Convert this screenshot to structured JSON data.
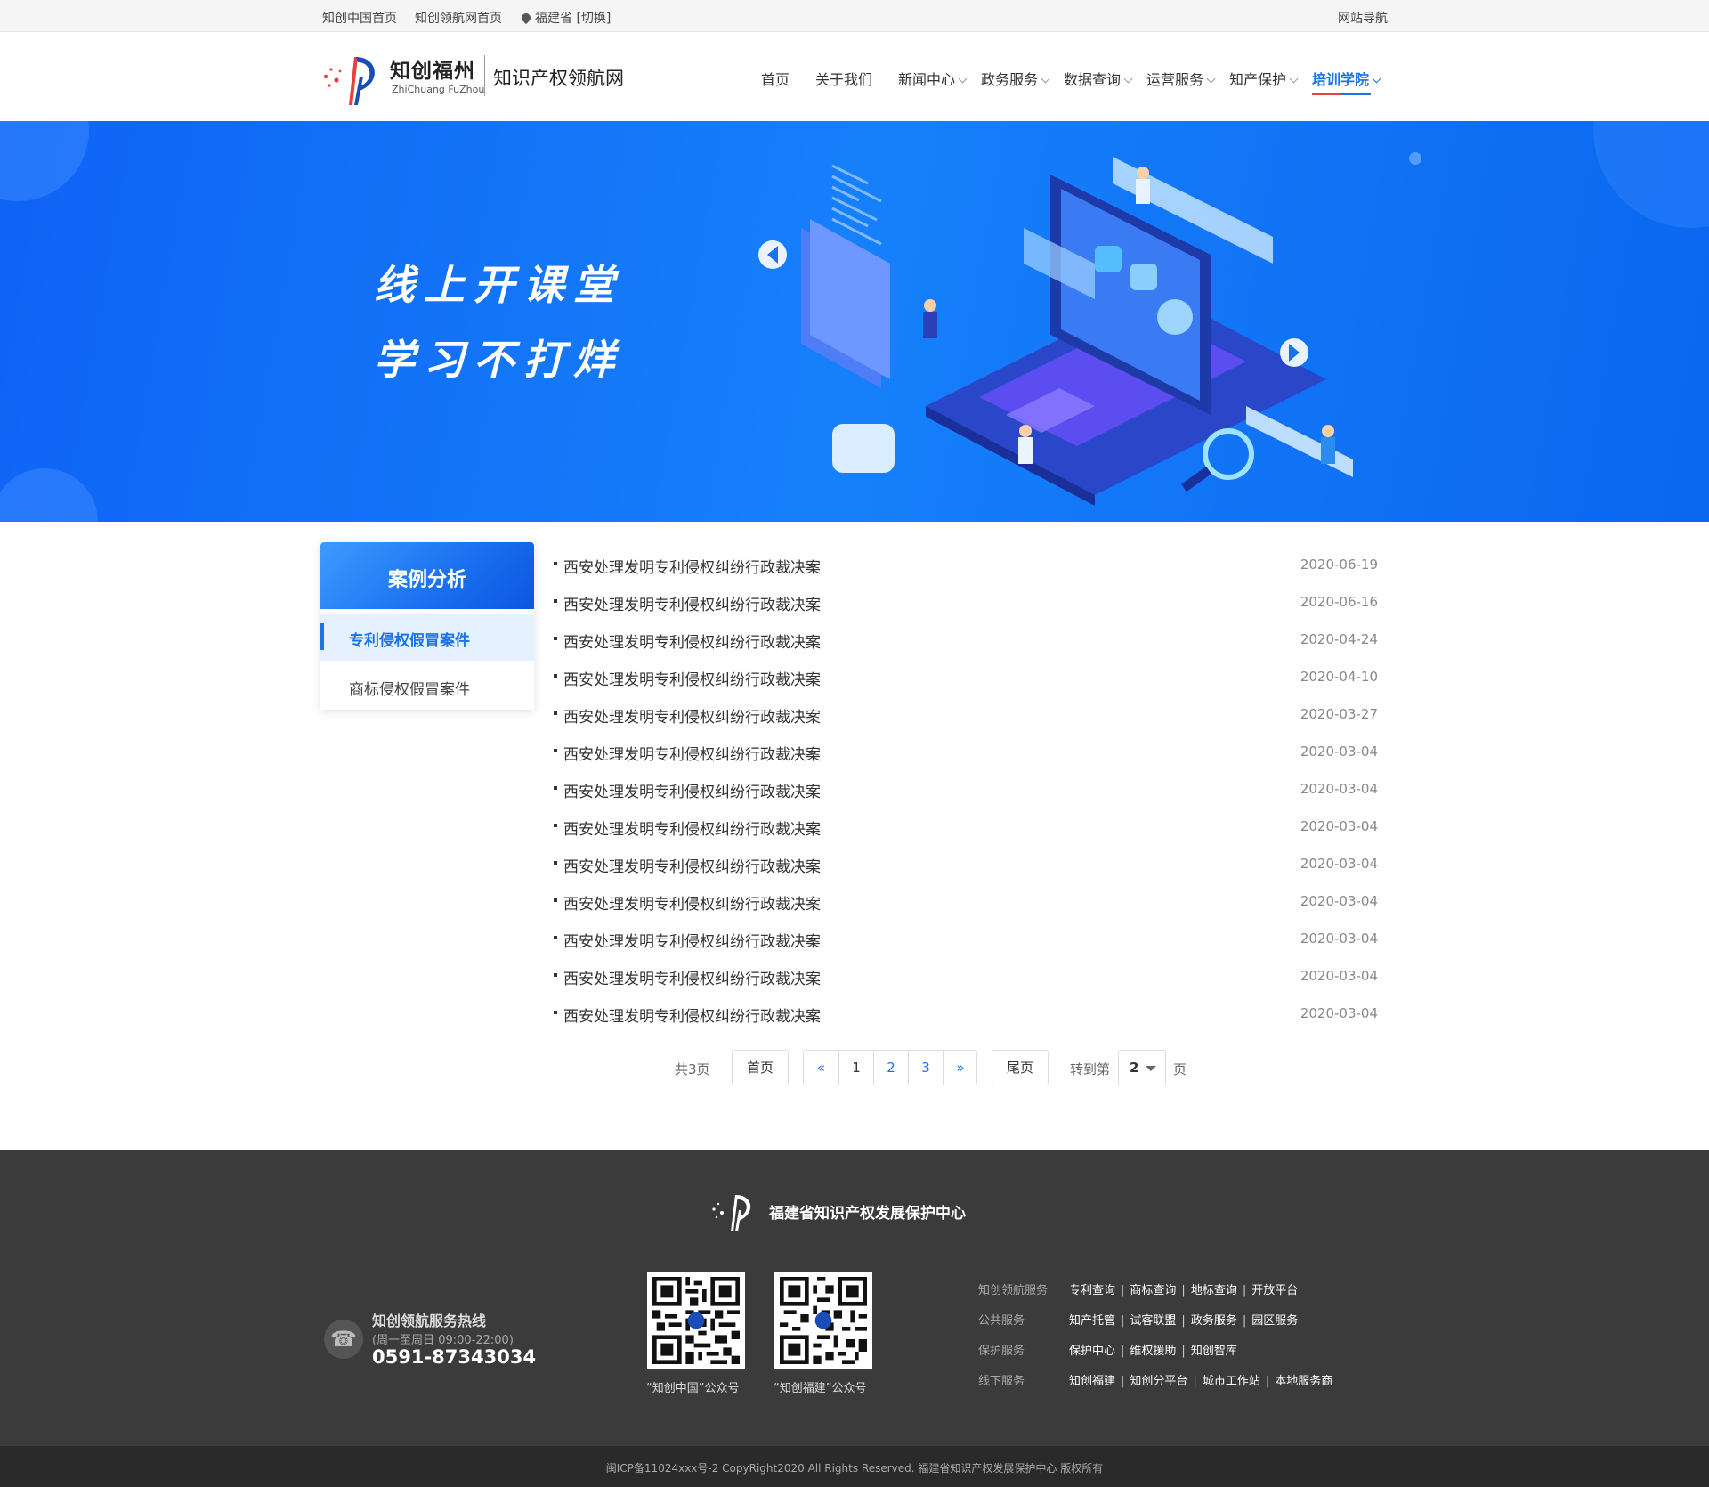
{
  "topbar": {
    "link1": "知创中国首页",
    "link2": "知创领航网首页",
    "location": "福建省 [切换]",
    "sitemap": "网站导航"
  },
  "header": {
    "logo_cn": "知创福州",
    "logo_en": "ZhiChuang FuZhou",
    "site_name": "知识产权领航网",
    "nav": [
      {
        "label": "首页",
        "dropdown": false
      },
      {
        "label": "关于我们",
        "dropdown": false
      },
      {
        "label": "新闻中心",
        "dropdown": true
      },
      {
        "label": "政务服务",
        "dropdown": true
      },
      {
        "label": "数据查询",
        "dropdown": true
      },
      {
        "label": "运营服务",
        "dropdown": true
      },
      {
        "label": "知产保护",
        "dropdown": true
      },
      {
        "label": "培训学院",
        "dropdown": true,
        "active": true
      }
    ]
  },
  "banner": {
    "line1": "线上开课堂",
    "line2": "学习不打烊"
  },
  "sidebar": {
    "title": "案例分析",
    "items": [
      {
        "label": "专利侵权假冒案件",
        "active": true
      },
      {
        "label": "商标侵权假冒案件",
        "active": false
      }
    ]
  },
  "articles": [
    {
      "title": "西安处理发明专利侵权纠纷行政裁决案",
      "date": "2020-06-19"
    },
    {
      "title": "西安处理发明专利侵权纠纷行政裁决案",
      "date": "2020-06-16"
    },
    {
      "title": "西安处理发明专利侵权纠纷行政裁决案",
      "date": "2020-04-24"
    },
    {
      "title": "西安处理发明专利侵权纠纷行政裁决案",
      "date": "2020-04-10"
    },
    {
      "title": "西安处理发明专利侵权纠纷行政裁决案",
      "date": "2020-03-27"
    },
    {
      "title": "西安处理发明专利侵权纠纷行政裁决案",
      "date": "2020-03-04"
    },
    {
      "title": "西安处理发明专利侵权纠纷行政裁决案",
      "date": "2020-03-04"
    },
    {
      "title": "西安处理发明专利侵权纠纷行政裁决案",
      "date": "2020-03-04"
    },
    {
      "title": "西安处理发明专利侵权纠纷行政裁决案",
      "date": "2020-03-04"
    },
    {
      "title": "西安处理发明专利侵权纠纷行政裁决案",
      "date": "2020-03-04"
    },
    {
      "title": "西安处理发明专利侵权纠纷行政裁决案",
      "date": "2020-03-04"
    },
    {
      "title": "西安处理发明专利侵权纠纷行政裁决案",
      "date": "2020-03-04"
    },
    {
      "title": "西安处理发明专利侵权纠纷行政裁决案",
      "date": "2020-03-04"
    }
  ],
  "pagination": {
    "total": "共3页",
    "first": "首页",
    "prev": "«",
    "pages": [
      "1",
      "2",
      "3"
    ],
    "next": "»",
    "last": "尾页",
    "goto": "转到第",
    "selected": "2",
    "unit": "页"
  },
  "footer": {
    "org": "福建省知识产权发展保护中心",
    "hotline_title": "知创领航服务热线",
    "hotline_hours": "(周一至周日 09:00-22:00)",
    "hotline_number": "0591-87343034",
    "qr1_caption": "“知创中国”公众号",
    "qr2_caption": "“知创福建”公众号",
    "services": [
      {
        "category": "知创领航服务",
        "links": [
          "专利查询",
          "商标查询",
          "地标查询",
          "开放平台"
        ]
      },
      {
        "category": "公共服务",
        "links": [
          "知产托管",
          "试客联盟",
          "政务服务",
          "园区服务"
        ]
      },
      {
        "category": "保护服务",
        "links": [
          "保护中心",
          "维权援助",
          "知创智库"
        ]
      },
      {
        "category": "线下服务",
        "links": [
          "知创福建",
          "知创分平台",
          "城市工作站",
          "本地服务商"
        ]
      }
    ],
    "copyright": "闽ICP备11024xxx号-2  CopyRight2020  All Rights Reserved.  福建省知识产权发展保护中心  版权所有"
  },
  "colors": {
    "accent": "#1a73e8",
    "brand_red": "#e8403a",
    "footer_bg": "#3b3b3b"
  }
}
